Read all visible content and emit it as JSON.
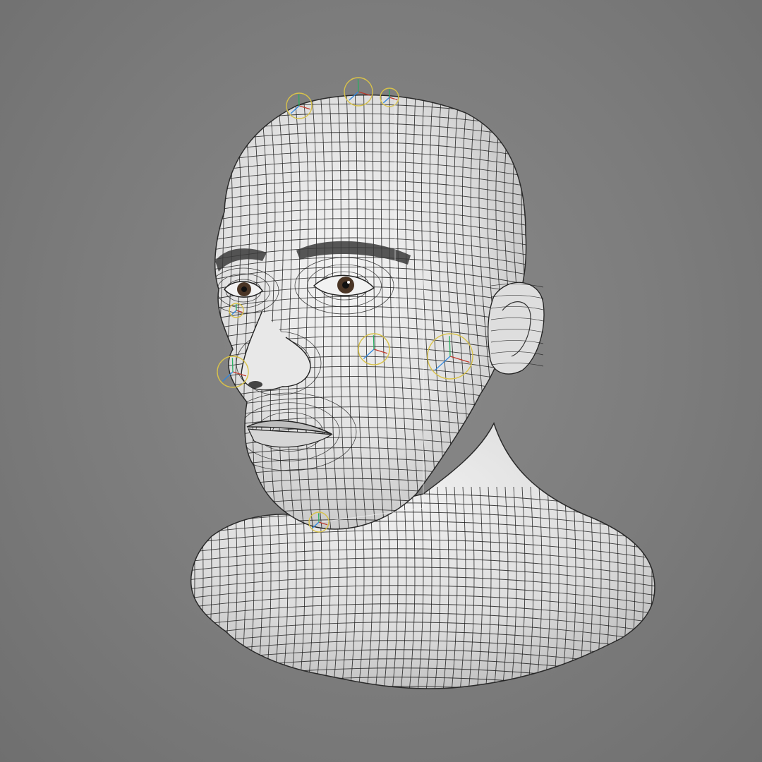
{
  "viewport": {
    "background_color": "#7c7c7c",
    "mesh_surface_color": "#e6e6e6",
    "wire_color": "#1e1e1e",
    "rig_handle_color": "#d8c24a",
    "rig_axis_colors": [
      "#c0392b",
      "#2e86de",
      "#27ae60"
    ],
    "object": "head-bust-wireframe-mesh"
  }
}
